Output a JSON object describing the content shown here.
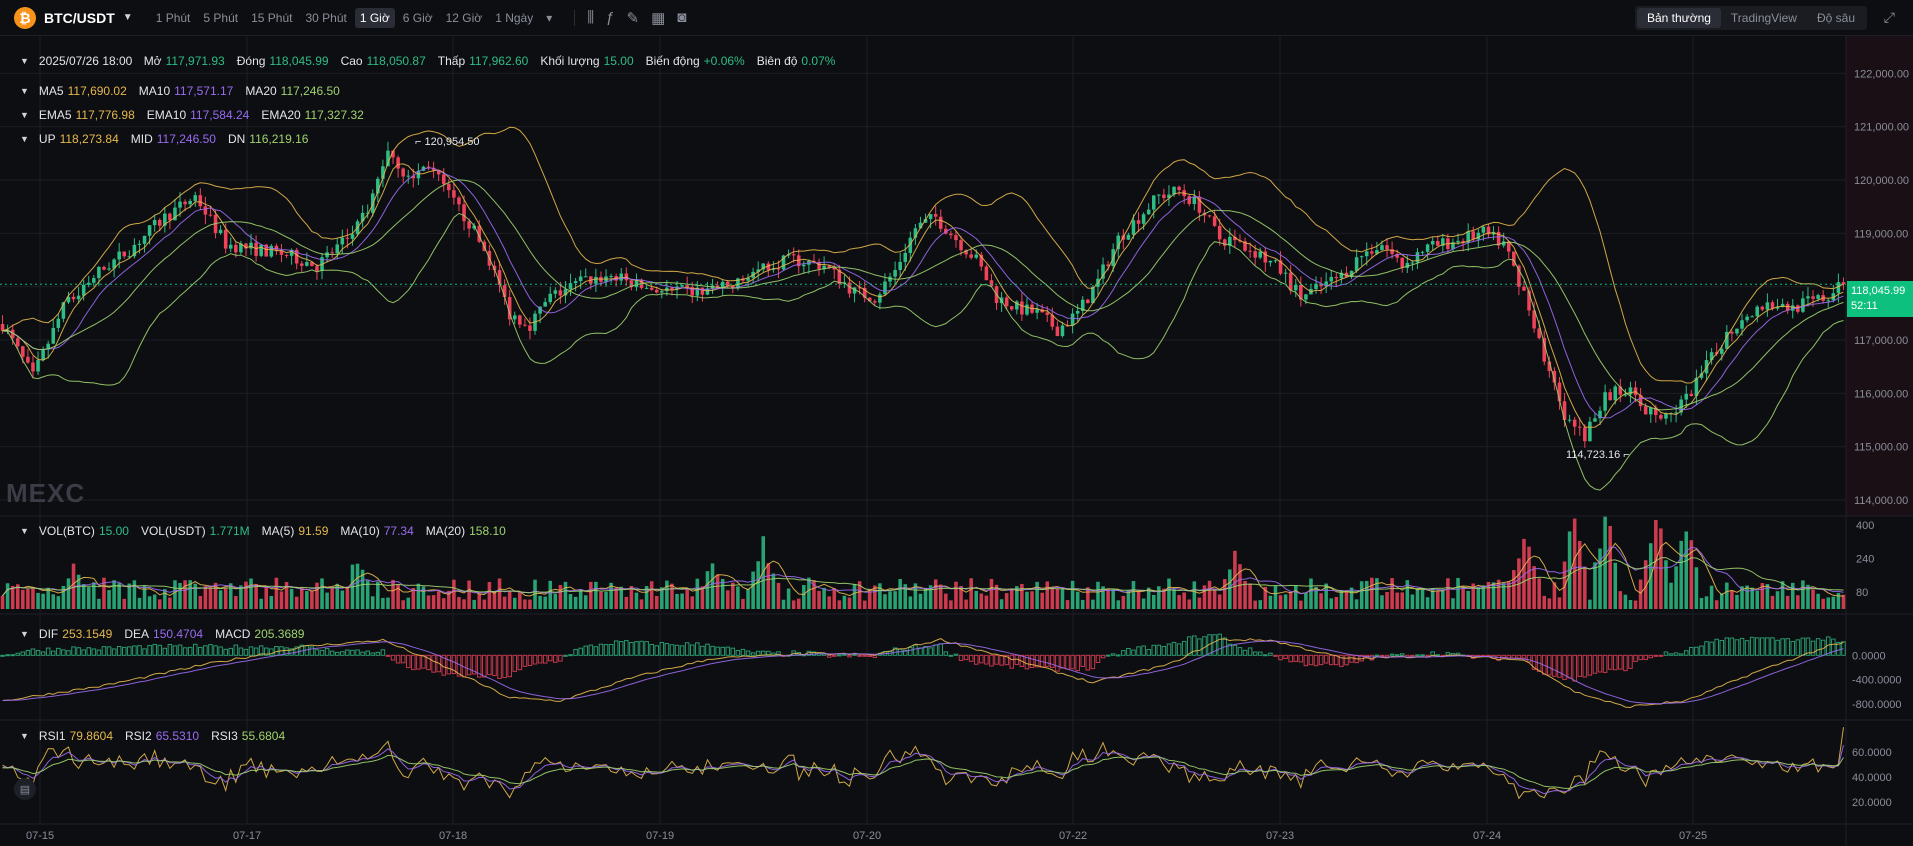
{
  "header": {
    "coin_symbol": "₿",
    "pair": "BTC/USDT",
    "intervals": [
      "1 Phút",
      "5 Phút",
      "15 Phút",
      "30 Phút",
      "1 Giờ",
      "6 Giờ",
      "12 Giờ",
      "1 Ngày"
    ],
    "active_interval": "1 Giờ",
    "views": [
      "Bản thường",
      "TradingView",
      "Độ sâu"
    ],
    "active_view": "Bản thường",
    "tool_icons": [
      "candle-style-icon",
      "indicator-fx-icon",
      "draw-pen-icon",
      "layout-grid-icon",
      "camera-icon"
    ]
  },
  "ohlc": {
    "date": "2025/07/26 18:00",
    "open_label": "Mở",
    "open": "117,971.93",
    "close_label": "Đóng",
    "close": "118,045.99",
    "high_label": "Cao",
    "high": "118,050.87",
    "low_label": "Thấp",
    "low": "117,962.60",
    "volume_label": "Khối lượng",
    "volume": "15.00",
    "change_label": "Biến động",
    "change": "+0.06%",
    "amplitude_label": "Biên độ",
    "amplitude": "0.07%"
  },
  "ma": {
    "ma5_label": "MA5",
    "ma5": "117,690.02",
    "ma10_label": "MA10",
    "ma10": "117,571.17",
    "ma20_label": "MA20",
    "ma20": "117,246.50"
  },
  "ema": {
    "ema5_label": "EMA5",
    "ema5": "117,776.98",
    "ema10_label": "EMA10",
    "ema10": "117,584.24",
    "ema20_label": "EMA20",
    "ema20": "117,327.32"
  },
  "boll": {
    "up_label": "UP",
    "up": "118,273.84",
    "mid_label": "MID",
    "mid": "117,246.50",
    "dn_label": "DN",
    "dn": "116,219.16"
  },
  "vol": {
    "btc_label": "VOL(BTC)",
    "btc": "15.00",
    "usdt_label": "VOL(USDT)",
    "usdt": "1.771M",
    "ma5_label": "MA(5)",
    "ma5": "91.59",
    "ma10_label": "MA(10)",
    "ma10": "77.34",
    "ma20_label": "MA(20)",
    "ma20": "158.10"
  },
  "macd": {
    "dif_label": "DIF",
    "dif": "253.1549",
    "dea_label": "DEA",
    "dea": "150.4704",
    "macd_label": "MACD",
    "macd": "205.3689"
  },
  "rsi": {
    "rsi1_label": "RSI1",
    "rsi1": "79.8604",
    "rsi2_label": "RSI2",
    "rsi2": "65.5310",
    "rsi3_label": "RSI3",
    "rsi3": "55.6804"
  },
  "last_price": {
    "price": "118,045.99",
    "countdown": "52:11"
  },
  "watermark": "MEXC",
  "colors": {
    "up": "#2ebd85",
    "down": "#f0435a",
    "ma5": "#e6b84c",
    "ma10": "#9a6cf0",
    "ma20": "#9fd36e",
    "bg": "#0d0e12",
    "grid": "#1c1e25"
  },
  "chart_data": {
    "type": "candlestick",
    "x_ticks": [
      "07-15",
      "07-17",
      "07-18",
      "07-19",
      "07-20",
      "07-22",
      "07-23",
      "07-24",
      "07-25"
    ],
    "price_axis": {
      "ticks": [
        "122,000.00",
        "121,000.00",
        "120,000.00",
        "119,000.00",
        "118,000.00",
        "117,000.00",
        "116,000.00",
        "115,000.00",
        "114,000.00"
      ],
      "ylim": [
        113700,
        122700
      ]
    },
    "annotations": {
      "max": "120,954.50",
      "min": "114,723.16"
    },
    "price_path": [
      [
        0,
        117300
      ],
      [
        6,
        116300
      ],
      [
        12,
        117600
      ],
      [
        18,
        118200
      ],
      [
        25,
        118700
      ],
      [
        32,
        119300
      ],
      [
        38,
        119700
      ],
      [
        44,
        118800
      ],
      [
        50,
        118700
      ],
      [
        56,
        118600
      ],
      [
        62,
        118400
      ],
      [
        68,
        118900
      ],
      [
        72,
        119400
      ],
      [
        76,
        120600
      ],
      [
        80,
        120000
      ],
      [
        84,
        120300
      ],
      [
        88,
        119700
      ],
      [
        92,
        119200
      ],
      [
        96,
        118500
      ],
      [
        100,
        117500
      ],
      [
        104,
        117300
      ],
      [
        108,
        117800
      ],
      [
        114,
        118100
      ],
      [
        120,
        118200
      ],
      [
        126,
        118000
      ],
      [
        132,
        117900
      ],
      [
        138,
        117900
      ],
      [
        144,
        118000
      ],
      [
        150,
        118400
      ],
      [
        156,
        118500
      ],
      [
        162,
        118400
      ],
      [
        168,
        117900
      ],
      [
        172,
        117800
      ],
      [
        176,
        118300
      ],
      [
        180,
        119100
      ],
      [
        184,
        119300
      ],
      [
        188,
        118900
      ],
      [
        192,
        118500
      ],
      [
        196,
        117800
      ],
      [
        200,
        117600
      ],
      [
        204,
        117500
      ],
      [
        208,
        117200
      ],
      [
        212,
        117500
      ],
      [
        216,
        118100
      ],
      [
        220,
        118900
      ],
      [
        224,
        119300
      ],
      [
        228,
        119700
      ],
      [
        232,
        119800
      ],
      [
        236,
        119500
      ],
      [
        240,
        118900
      ],
      [
        244,
        118800
      ],
      [
        248,
        118600
      ],
      [
        252,
        118300
      ],
      [
        256,
        117800
      ],
      [
        260,
        118000
      ],
      [
        264,
        118200
      ],
      [
        268,
        118600
      ],
      [
        272,
        118800
      ],
      [
        276,
        118400
      ],
      [
        280,
        118700
      ],
      [
        284,
        118800
      ],
      [
        288,
        118900
      ],
      [
        292,
        119000
      ],
      [
        296,
        118800
      ],
      [
        300,
        117900
      ],
      [
        304,
        116700
      ],
      [
        308,
        115500
      ],
      [
        312,
        115200
      ],
      [
        316,
        115900
      ],
      [
        320,
        116100
      ],
      [
        324,
        115700
      ],
      [
        328,
        115500
      ],
      [
        332,
        115900
      ],
      [
        336,
        116500
      ],
      [
        340,
        117100
      ],
      [
        344,
        117500
      ],
      [
        348,
        117700
      ],
      [
        352,
        117600
      ],
      [
        356,
        117700
      ],
      [
        360,
        117800
      ],
      [
        363,
        118050
      ]
    ],
    "volume_axis": {
      "ticks": [
        "400",
        "240",
        "80"
      ],
      "ylim": [
        0,
        520
      ]
    },
    "volume_spikes": [
      [
        14,
        220
      ],
      [
        70,
        260
      ],
      [
        140,
        220
      ],
      [
        150,
        330
      ],
      [
        243,
        280
      ],
      [
        300,
        380
      ],
      [
        310,
        500
      ],
      [
        316,
        480
      ],
      [
        326,
        470
      ],
      [
        332,
        400
      ]
    ],
    "macd_axis": {
      "ticks": [
        "0.0000",
        "-400.0000",
        "-800.0000"
      ],
      "ylim": [
        -1000,
        500
      ]
    },
    "macd_path": [
      [
        0,
        -750
      ],
      [
        20,
        -500
      ],
      [
        40,
        -150
      ],
      [
        60,
        150
      ],
      [
        75,
        250
      ],
      [
        85,
        -100
      ],
      [
        100,
        -700
      ],
      [
        110,
        -750
      ],
      [
        125,
        -350
      ],
      [
        140,
        -50
      ],
      [
        160,
        30
      ],
      [
        172,
        10
      ],
      [
        185,
        260
      ],
      [
        200,
        -80
      ],
      [
        215,
        -450
      ],
      [
        230,
        -150
      ],
      [
        240,
        260
      ],
      [
        250,
        250
      ],
      [
        265,
        -60
      ],
      [
        285,
        0
      ],
      [
        300,
        -80
      ],
      [
        310,
        -600
      ],
      [
        320,
        -850
      ],
      [
        332,
        -750
      ],
      [
        345,
        -300
      ],
      [
        360,
        150
      ],
      [
        363,
        200
      ]
    ],
    "rsi_axis": {
      "ticks": [
        "60.0000",
        "40.0000",
        "20.0000"
      ],
      "ylim": [
        5,
        80
      ]
    },
    "rsi_base": 47
  }
}
